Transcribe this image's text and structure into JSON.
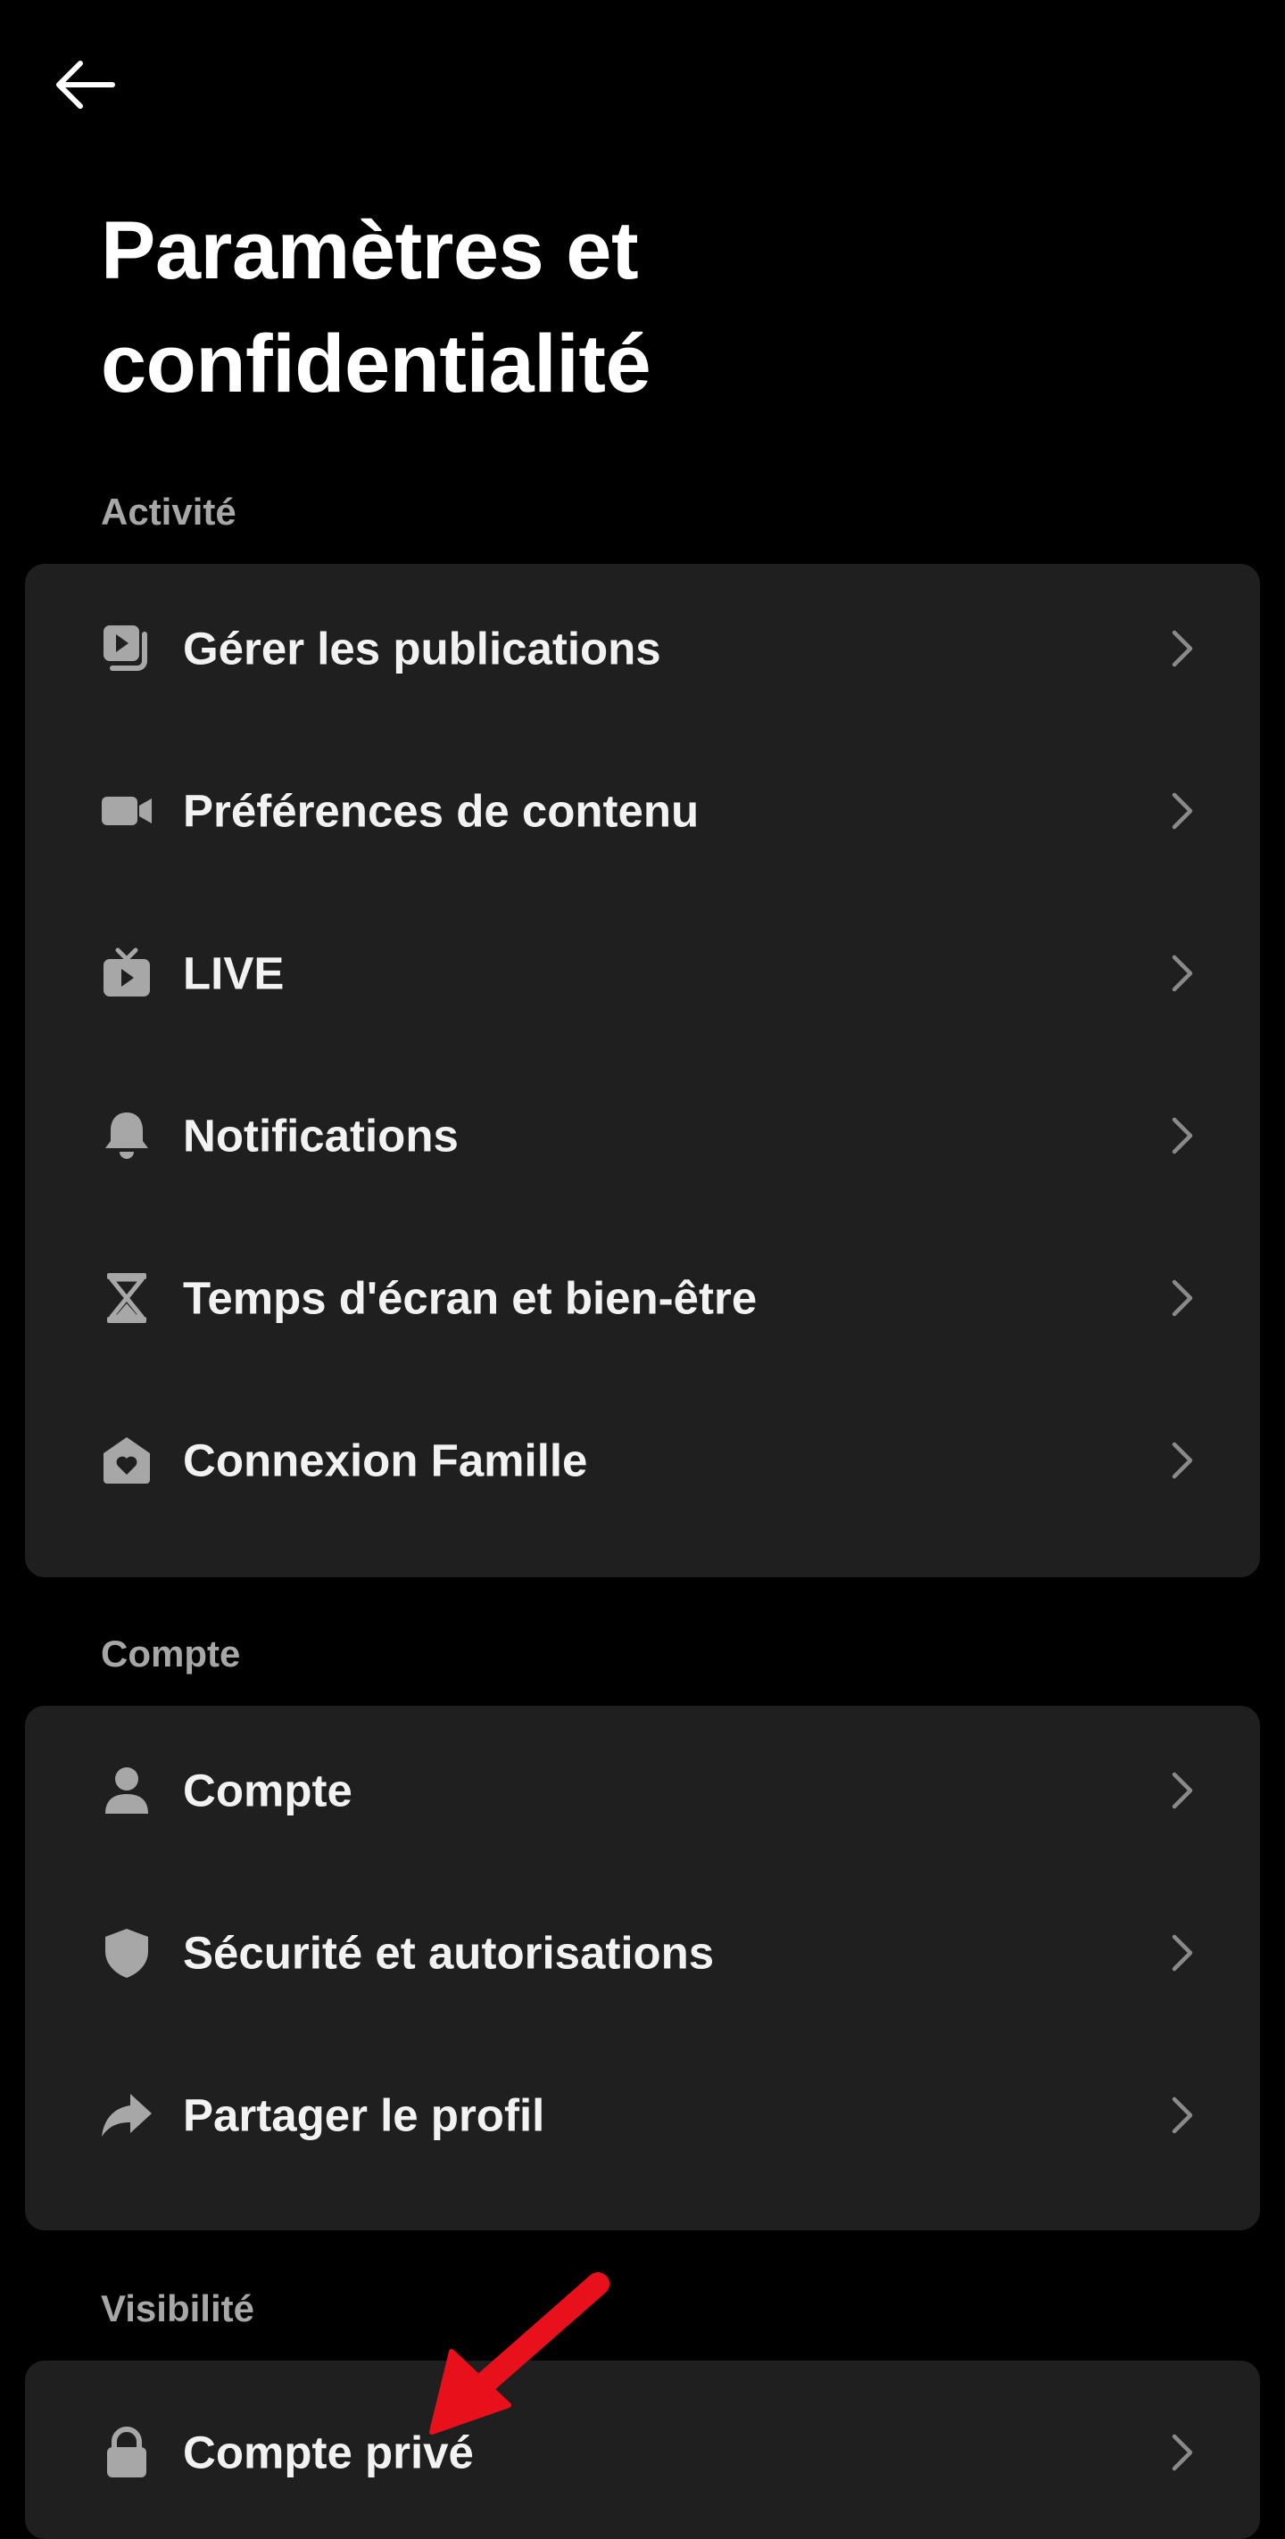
{
  "header": {
    "back_icon": "arrow-left-icon",
    "title": "Paramètres et confidentialité"
  },
  "colors": {
    "background": "#000000",
    "card": "#1f1f1f",
    "section_label": "#a7a7a7",
    "icon": "#a7a7a7",
    "annotation_arrow": "#e8101a"
  },
  "sections": [
    {
      "label": "Activité",
      "items": [
        {
          "label": "Gérer les publications",
          "icon": "posts-icon"
        },
        {
          "label": "Préférences de contenu",
          "icon": "video-camera-icon"
        },
        {
          "label": "LIVE",
          "icon": "tv-icon"
        },
        {
          "label": "Notifications",
          "icon": "bell-icon"
        },
        {
          "label": "Temps d'écran et bien-être",
          "icon": "hourglass-icon"
        },
        {
          "label": "Connexion Famille",
          "icon": "house-heart-icon"
        }
      ]
    },
    {
      "label": "Compte",
      "items": [
        {
          "label": "Compte",
          "icon": "person-icon"
        },
        {
          "label": "Sécurité et autorisations",
          "icon": "shield-icon"
        },
        {
          "label": "Partager le profil",
          "icon": "share-icon"
        }
      ]
    },
    {
      "label": "Visibilité",
      "items": [
        {
          "label": "Compte privé",
          "icon": "lock-icon"
        }
      ]
    }
  ]
}
